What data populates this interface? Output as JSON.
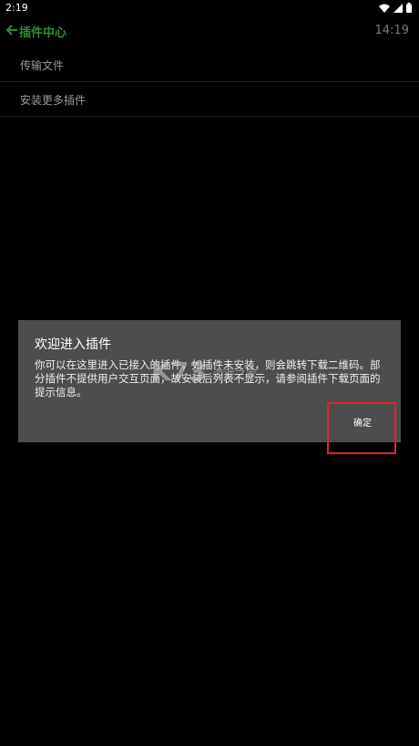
{
  "status": {
    "time": "2:19"
  },
  "appbar": {
    "title": "插件中心",
    "clock": "14:19"
  },
  "menu": {
    "items": [
      {
        "label": "传输文件"
      },
      {
        "label": "安装更多插件"
      }
    ]
  },
  "dialog": {
    "title": "欢迎进入插件",
    "body": "你可以在这里进入已接入的插件，如插件未安装，则会跳转下载二维码。部分插件不提供用户交互页面，故安装后列表不显示，请参阅插件下载页面的提示信息。",
    "ok_label": "确定"
  },
  "watermark": {
    "logo": "K73",
    "text": "游戏之家"
  },
  "colors": {
    "accent_title": "#2e8b3a",
    "highlight": "#e0262b",
    "dialog_bg": "#4d4d4d"
  }
}
